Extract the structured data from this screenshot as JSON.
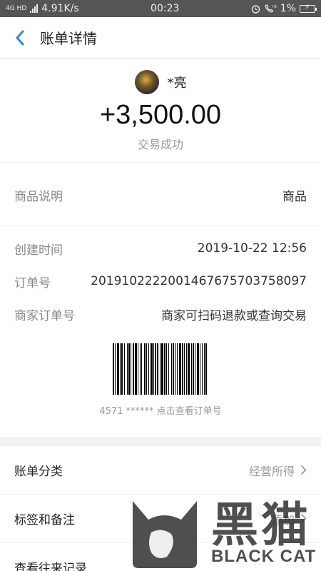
{
  "status_bar": {
    "network": "4G HD",
    "speed": "4.91K/s",
    "time": "00:23",
    "icons": [
      "alarm-icon",
      "call-hd-icon"
    ],
    "battery": "1%"
  },
  "nav": {
    "title": "账单详情"
  },
  "summary": {
    "username": "*亮",
    "amount": "+3,500.00",
    "status": "交易成功"
  },
  "goods": {
    "label": "商品说明",
    "value": "商品"
  },
  "details": {
    "created_label": "创建时间",
    "created_value": "2019-10-22 12:56",
    "order_label": "订单号",
    "order_value": "20191022220014676757037580​97",
    "merchant_label": "商家订单号",
    "merchant_value": "商家可扫码退款或查询交易",
    "barcode_hint": "4571 ****** 点击查看订单号"
  },
  "menu": {
    "category_label": "账单分类",
    "category_value": "经营所得",
    "tag_label": "标签和备注",
    "tag_value": "添加",
    "history_label": "查看往来记录"
  },
  "watermark": {
    "cn": "黑猫",
    "en": "BLACK CAT"
  },
  "colors": {
    "accent": "#2f86d6",
    "statusbar": "#555555"
  }
}
